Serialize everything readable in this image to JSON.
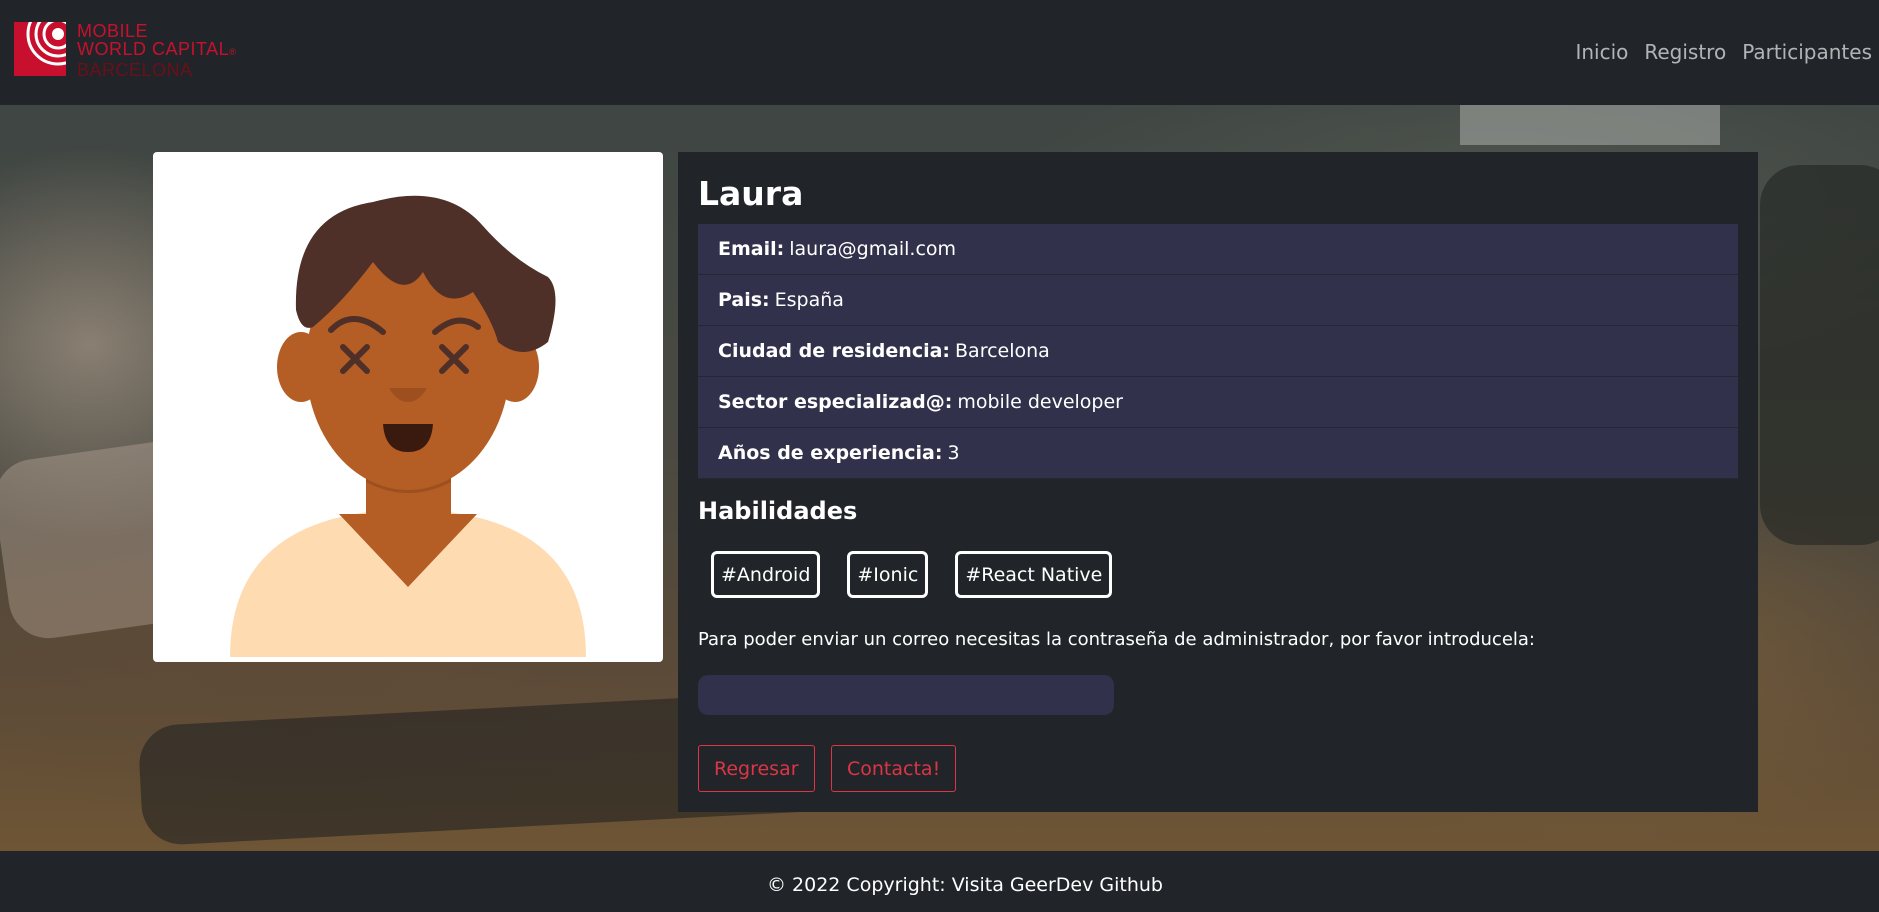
{
  "brand": {
    "line1": "MOBILE",
    "line2": "WORLD CAPITAL",
    "line2_mark": "®",
    "line3": "BARCELONA",
    "logo_icon": "mwc-concentric-circles-logo",
    "color": "#c8102e"
  },
  "nav": {
    "items": [
      {
        "label": "Inicio"
      },
      {
        "label": "Registro"
      },
      {
        "label": "Participantes"
      }
    ]
  },
  "profile": {
    "avatar_icon": "cartoon-person-avatar",
    "name": "Laura",
    "info": [
      {
        "label": "Email:",
        "value": "laura@gmail.com"
      },
      {
        "label": "Pais:",
        "value": "España"
      },
      {
        "label": "Ciudad de residencia:",
        "value": "Barcelona"
      },
      {
        "label": "Sector especializad@:",
        "value": "mobile developer"
      },
      {
        "label": "Años de experiencia:",
        "value": "3"
      }
    ],
    "skills_title": "Habilidades",
    "skills": [
      "#Android",
      "#Ionic",
      "#React Native"
    ],
    "password_note": "Para poder enviar un correo necesitas la contraseña de administrador, por favor introducela:",
    "password_value": "",
    "password_placeholder": "",
    "back_label": "Regresar",
    "contact_label": "Contacta!"
  },
  "footer": {
    "text": "© 2022 Copyright: Visita GeerDev Github"
  },
  "colors": {
    "background": "#212529",
    "list_item": "#31314b",
    "danger": "#dc3545",
    "brand": "#c8102e"
  }
}
